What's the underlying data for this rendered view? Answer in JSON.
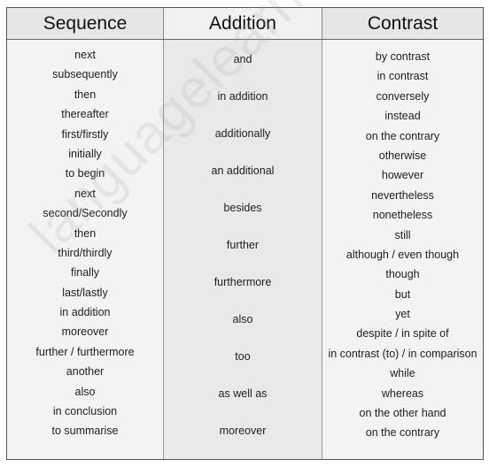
{
  "headers": {
    "sequence": "Sequence",
    "addition": "Addition",
    "contrast": "Contrast"
  },
  "sequence": [
    "next",
    "subsequently",
    "then",
    "thereafter",
    "first/firstly",
    "initially",
    "to begin",
    "next",
    "second/Secondly",
    "then",
    "third/thirdly",
    "finally",
    "last/lastly",
    "in addition",
    "moreover",
    "further / furthermore",
    "another",
    "also",
    "in conclusion",
    "to summarise"
  ],
  "addition": [
    "and",
    "in addition",
    "additionally",
    "an additional",
    "besides",
    "further",
    "furthermore",
    "also",
    "too",
    "as well as",
    "moreover"
  ],
  "contrast": [
    "by contrast",
    "in contrast",
    "conversely",
    "instead",
    "on the contrary",
    "otherwise",
    "however",
    "nevertheless",
    "nonetheless",
    "still",
    "although / even though",
    "though",
    "but",
    "yet",
    "despite / in spite of",
    "in contrast (to) / in comparison",
    "while",
    "whereas",
    "on the other hand",
    "on the contrary"
  ],
  "watermark": "languagelearningbase.com"
}
